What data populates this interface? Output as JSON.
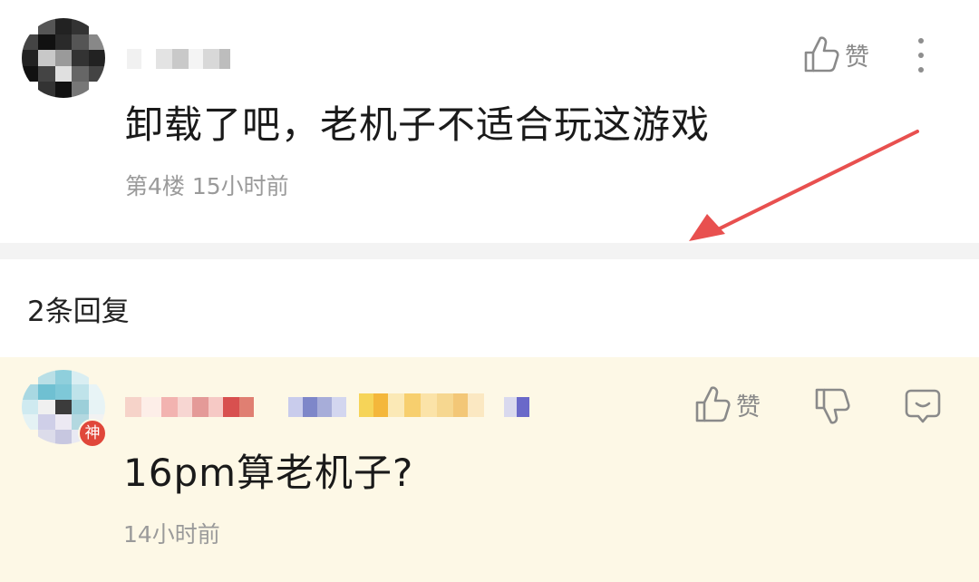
{
  "main_comment": {
    "text": "卸载了吧，老机子不适合玩这游戏",
    "floor": "第4楼",
    "time": "15小时前",
    "like_label": "赞",
    "icons": {
      "like": "thumbs-up-icon",
      "more": "more-vertical-icon"
    }
  },
  "replies_header": {
    "count_label": "2条回复"
  },
  "reply": {
    "text": "16pm算老机子?",
    "time": "14小时前",
    "like_label": "赞",
    "badge": "神",
    "icons": {
      "like": "thumbs-up-icon",
      "dislike": "thumbs-down-icon",
      "reply": "comment-bubble-icon"
    }
  },
  "colors": {
    "accent_arrow": "#e8504f",
    "reply_background": "#fdf8e6",
    "divider": "#f3f3f3",
    "badge": "#e0473a"
  }
}
